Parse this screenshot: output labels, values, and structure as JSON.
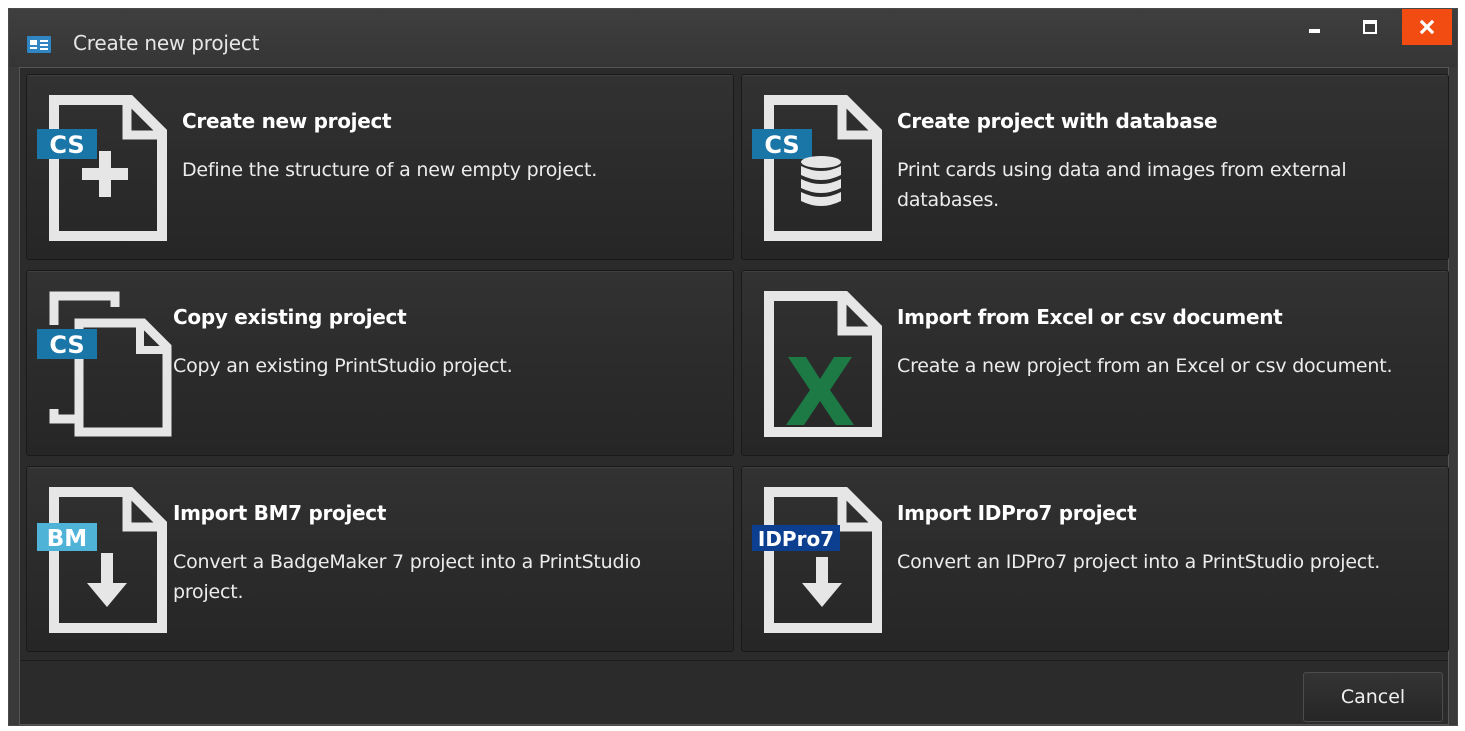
{
  "window": {
    "title": "Create new project",
    "controls": {
      "minimize": "minimize-icon",
      "maximize": "maximize-icon",
      "close": "close-icon"
    },
    "close_color": "#f24c12"
  },
  "options": [
    {
      "title": "Create new project",
      "description": "Define the structure of a new empty project.",
      "badge": "CS",
      "icon": "new-document-icon"
    },
    {
      "title": "Create project with database",
      "description": "Print cards using data and images from external databases.",
      "badge": "CS",
      "icon": "database-document-icon"
    },
    {
      "title": "Copy existing project",
      "description": "Copy an existing PrintStudio project.",
      "badge": "CS",
      "icon": "copy-documents-icon"
    },
    {
      "title": "Import from Excel or csv document",
      "description": "Create a new project from an Excel or csv document.",
      "badge": "",
      "icon": "excel-document-icon"
    },
    {
      "title": "Import BM7 project",
      "description": "Convert a BadgeMaker 7 project into a PrintStudio project.",
      "badge": "BM",
      "icon": "import-document-icon"
    },
    {
      "title": "Import IDPro7 project",
      "description": "Convert an IDPro7 project into a PrintStudio project.",
      "badge": "IDPro7",
      "icon": "import-document-icon"
    }
  ],
  "colors": {
    "cs_badge": "#1b76a8",
    "bm_badge": "#4fb3d8",
    "idpro_badge": "#0c3f8f",
    "excel_green": "#1d7a45"
  },
  "footer": {
    "cancel_label": "Cancel"
  }
}
